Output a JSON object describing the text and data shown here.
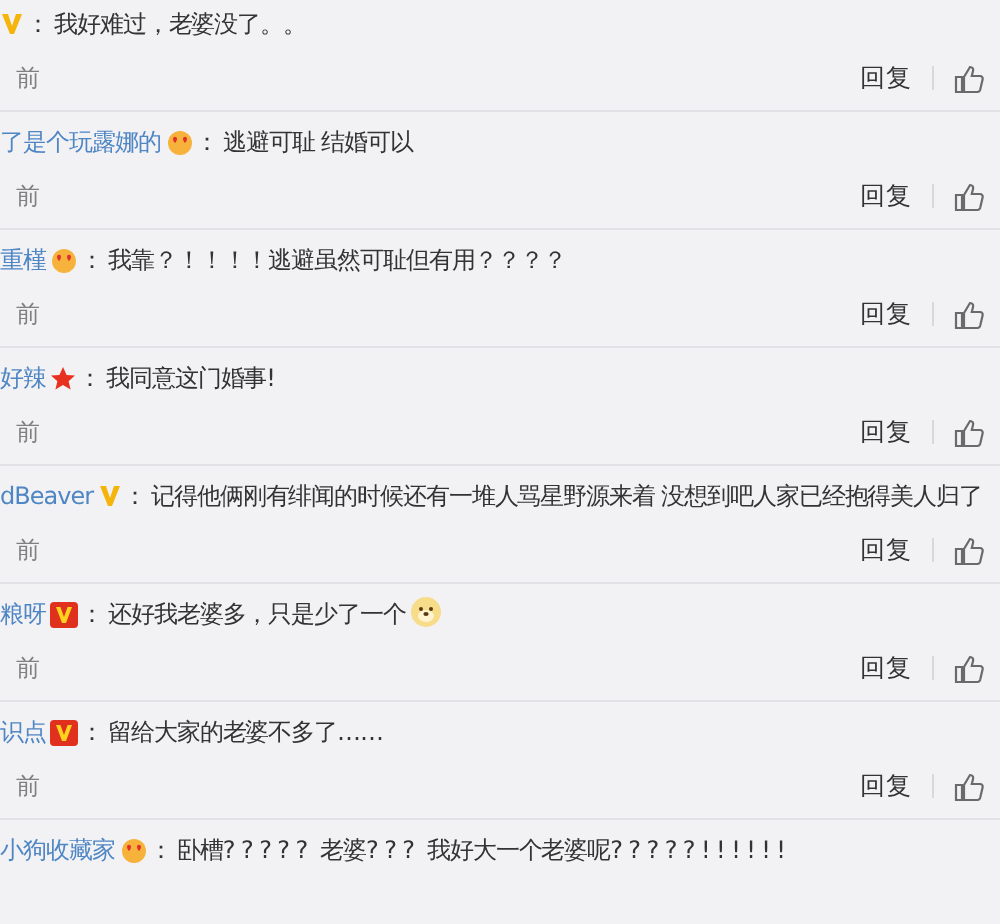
{
  "comments": [
    {
      "badge": {
        "kind": "v_gold"
      },
      "separator": "：",
      "text": "我好难过，老婆没了。。",
      "time": "前",
      "reply": "回复"
    },
    {
      "user": "了是个玩露娜的",
      "badge": {
        "kind": "crown"
      },
      "separator": "：",
      "text": "逃避可耻 结婚可以",
      "time": "前",
      "reply": "回复"
    },
    {
      "user": "重槿",
      "badge": {
        "kind": "crown"
      },
      "separator": "：",
      "text": "我靠？！！！！逃避虽然可耻但有用？？？？",
      "time": "前",
      "reply": "回复"
    },
    {
      "user": "好辣",
      "badge": {
        "kind": "star"
      },
      "separator": "：",
      "text": "我同意这门婚事!",
      "time": "前",
      "reply": "回复"
    },
    {
      "user": "dBeaver",
      "badge": {
        "kind": "v_gold"
      },
      "separator": "：",
      "text": "记得他俩刚有绯闻的时候还有一堆人骂星野源来着 没想到吧人家已经抱得美人归了",
      "time": "前",
      "reply": "回复"
    },
    {
      "user": "粮呀",
      "badge": {
        "kind": "v_red"
      },
      "separator": "：",
      "text": "还好我老婆多，只是少了一个",
      "emoji": true,
      "time": "前",
      "reply": "回复"
    },
    {
      "user": "识点",
      "badge": {
        "kind": "v_red"
      },
      "separator": "：",
      "text": "留给大家的老婆不多了……",
      "time": "前",
      "reply": "回复"
    },
    {
      "user": "小狗收藏家",
      "badge": {
        "kind": "crown"
      },
      "separator": "：",
      "text": "卧槽? ? ? ? ?  老婆? ? ?  我好大一个老婆呢? ? ? ? ? ! ! ! ! ! !"
    }
  ]
}
